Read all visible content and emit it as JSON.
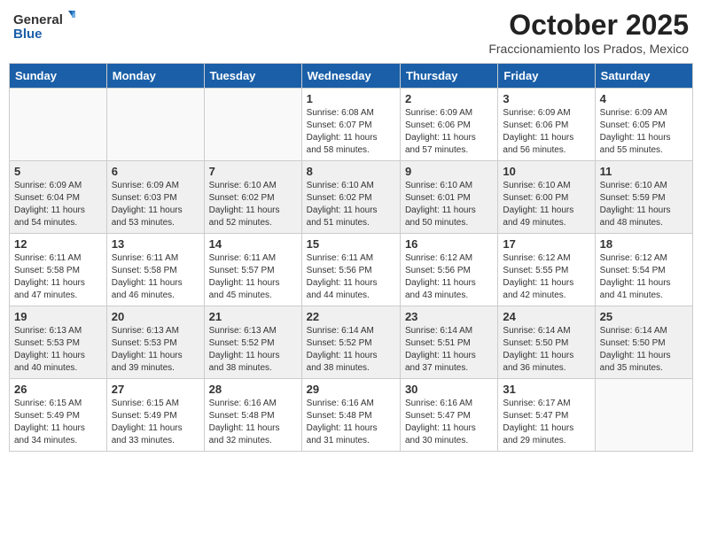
{
  "header": {
    "logo_general": "General",
    "logo_blue": "Blue",
    "month_title": "October 2025",
    "subtitle": "Fraccionamiento los Prados, Mexico"
  },
  "days_of_week": [
    "Sunday",
    "Monday",
    "Tuesday",
    "Wednesday",
    "Thursday",
    "Friday",
    "Saturday"
  ],
  "weeks": [
    [
      {
        "day": "",
        "info": ""
      },
      {
        "day": "",
        "info": ""
      },
      {
        "day": "",
        "info": ""
      },
      {
        "day": "1",
        "info": "Sunrise: 6:08 AM\nSunset: 6:07 PM\nDaylight: 11 hours\nand 58 minutes."
      },
      {
        "day": "2",
        "info": "Sunrise: 6:09 AM\nSunset: 6:06 PM\nDaylight: 11 hours\nand 57 minutes."
      },
      {
        "day": "3",
        "info": "Sunrise: 6:09 AM\nSunset: 6:06 PM\nDaylight: 11 hours\nand 56 minutes."
      },
      {
        "day": "4",
        "info": "Sunrise: 6:09 AM\nSunset: 6:05 PM\nDaylight: 11 hours\nand 55 minutes."
      }
    ],
    [
      {
        "day": "5",
        "info": "Sunrise: 6:09 AM\nSunset: 6:04 PM\nDaylight: 11 hours\nand 54 minutes."
      },
      {
        "day": "6",
        "info": "Sunrise: 6:09 AM\nSunset: 6:03 PM\nDaylight: 11 hours\nand 53 minutes."
      },
      {
        "day": "7",
        "info": "Sunrise: 6:10 AM\nSunset: 6:02 PM\nDaylight: 11 hours\nand 52 minutes."
      },
      {
        "day": "8",
        "info": "Sunrise: 6:10 AM\nSunset: 6:02 PM\nDaylight: 11 hours\nand 51 minutes."
      },
      {
        "day": "9",
        "info": "Sunrise: 6:10 AM\nSunset: 6:01 PM\nDaylight: 11 hours\nand 50 minutes."
      },
      {
        "day": "10",
        "info": "Sunrise: 6:10 AM\nSunset: 6:00 PM\nDaylight: 11 hours\nand 49 minutes."
      },
      {
        "day": "11",
        "info": "Sunrise: 6:10 AM\nSunset: 5:59 PM\nDaylight: 11 hours\nand 48 minutes."
      }
    ],
    [
      {
        "day": "12",
        "info": "Sunrise: 6:11 AM\nSunset: 5:58 PM\nDaylight: 11 hours\nand 47 minutes."
      },
      {
        "day": "13",
        "info": "Sunrise: 6:11 AM\nSunset: 5:58 PM\nDaylight: 11 hours\nand 46 minutes."
      },
      {
        "day": "14",
        "info": "Sunrise: 6:11 AM\nSunset: 5:57 PM\nDaylight: 11 hours\nand 45 minutes."
      },
      {
        "day": "15",
        "info": "Sunrise: 6:11 AM\nSunset: 5:56 PM\nDaylight: 11 hours\nand 44 minutes."
      },
      {
        "day": "16",
        "info": "Sunrise: 6:12 AM\nSunset: 5:56 PM\nDaylight: 11 hours\nand 43 minutes."
      },
      {
        "day": "17",
        "info": "Sunrise: 6:12 AM\nSunset: 5:55 PM\nDaylight: 11 hours\nand 42 minutes."
      },
      {
        "day": "18",
        "info": "Sunrise: 6:12 AM\nSunset: 5:54 PM\nDaylight: 11 hours\nand 41 minutes."
      }
    ],
    [
      {
        "day": "19",
        "info": "Sunrise: 6:13 AM\nSunset: 5:53 PM\nDaylight: 11 hours\nand 40 minutes."
      },
      {
        "day": "20",
        "info": "Sunrise: 6:13 AM\nSunset: 5:53 PM\nDaylight: 11 hours\nand 39 minutes."
      },
      {
        "day": "21",
        "info": "Sunrise: 6:13 AM\nSunset: 5:52 PM\nDaylight: 11 hours\nand 38 minutes."
      },
      {
        "day": "22",
        "info": "Sunrise: 6:14 AM\nSunset: 5:52 PM\nDaylight: 11 hours\nand 38 minutes."
      },
      {
        "day": "23",
        "info": "Sunrise: 6:14 AM\nSunset: 5:51 PM\nDaylight: 11 hours\nand 37 minutes."
      },
      {
        "day": "24",
        "info": "Sunrise: 6:14 AM\nSunset: 5:50 PM\nDaylight: 11 hours\nand 36 minutes."
      },
      {
        "day": "25",
        "info": "Sunrise: 6:14 AM\nSunset: 5:50 PM\nDaylight: 11 hours\nand 35 minutes."
      }
    ],
    [
      {
        "day": "26",
        "info": "Sunrise: 6:15 AM\nSunset: 5:49 PM\nDaylight: 11 hours\nand 34 minutes."
      },
      {
        "day": "27",
        "info": "Sunrise: 6:15 AM\nSunset: 5:49 PM\nDaylight: 11 hours\nand 33 minutes."
      },
      {
        "day": "28",
        "info": "Sunrise: 6:16 AM\nSunset: 5:48 PM\nDaylight: 11 hours\nand 32 minutes."
      },
      {
        "day": "29",
        "info": "Sunrise: 6:16 AM\nSunset: 5:48 PM\nDaylight: 11 hours\nand 31 minutes."
      },
      {
        "day": "30",
        "info": "Sunrise: 6:16 AM\nSunset: 5:47 PM\nDaylight: 11 hours\nand 30 minutes."
      },
      {
        "day": "31",
        "info": "Sunrise: 6:17 AM\nSunset: 5:47 PM\nDaylight: 11 hours\nand 29 minutes."
      },
      {
        "day": "",
        "info": ""
      }
    ]
  ]
}
